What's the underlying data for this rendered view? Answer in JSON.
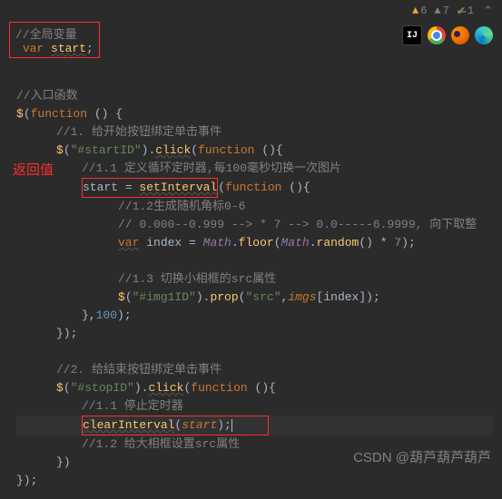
{
  "toolbar": {
    "warn_yellow_count": "6",
    "warn_grey_count": "7",
    "check_count": "1",
    "ide_label": "IJ"
  },
  "boxes": {
    "global_l1": "//全局变量",
    "global_l2_kw": "var",
    "global_l2_var": "start",
    "ret_label": "返回值"
  },
  "code": {
    "c_entry": "//入口函数",
    "dollar": "$",
    "fn_kw": "function",
    "c1": "//1. 给开始按钮绑定单击事件",
    "startID": "\"#startID\"",
    "click": "click",
    "c1_1": "//1.1 定义循环定时器,每100毫秒切换一次图片",
    "start_var": "start",
    "setInterval": "setInterval",
    "c1_2": "//1.2生成随机角标0-6",
    "c_math": "// 0.000--0.999 --> * 7 --> 0.0-----6.9999, 向下取整",
    "var_kw": "var",
    "index_var": "index",
    "Math": "Math",
    "floor": "floor",
    "random": "random",
    "seven": "7",
    "c1_3": "//1.3 切换小相框的src属性",
    "img1ID": "\"#img1ID\"",
    "prop": "prop",
    "src": "\"src\"",
    "imgs": "imgs",
    "hundred": "100",
    "c2": "//2. 给结束按钮绑定单击事件",
    "stopID": "\"#stopID\"",
    "c2_1": "//1.1 停止定时器",
    "clearInterval": "clearInterval",
    "c2_2": "//1.2 给大相框设置src属性"
  },
  "watermark": "CSDN @葫芦葫芦葫芦"
}
